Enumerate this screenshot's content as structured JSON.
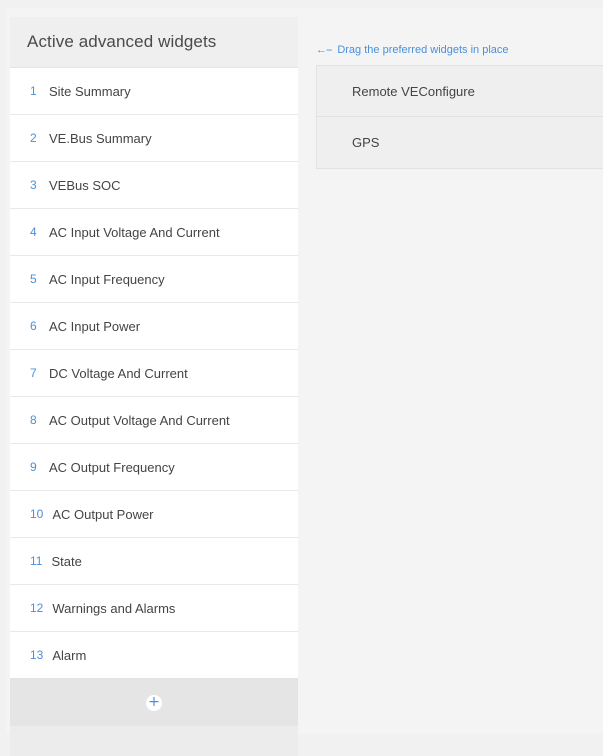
{
  "active_panel": {
    "title": "Active advanced widgets",
    "items": [
      {
        "num": "1",
        "label": "Site Summary"
      },
      {
        "num": "2",
        "label": "VE.Bus Summary"
      },
      {
        "num": "3",
        "label": "VEBus SOC"
      },
      {
        "num": "4",
        "label": "AC Input Voltage And Current"
      },
      {
        "num": "5",
        "label": "AC Input Frequency"
      },
      {
        "num": "6",
        "label": "AC Input Power"
      },
      {
        "num": "7",
        "label": "DC Voltage And Current"
      },
      {
        "num": "8",
        "label": "AC Output Voltage And Current"
      },
      {
        "num": "9",
        "label": "AC Output Frequency"
      },
      {
        "num": "10",
        "label": "AC Output Power"
      },
      {
        "num": "11",
        "label": "State"
      },
      {
        "num": "12",
        "label": "Warnings and Alarms"
      },
      {
        "num": "13",
        "label": "Alarm"
      }
    ],
    "add_icon": "plus-icon",
    "add_symbol": "+"
  },
  "available_panel": {
    "hint_arrow": "←--",
    "hint_text": "Drag the preferred widgets in place",
    "items": [
      {
        "label": "Remote VEConfigure"
      },
      {
        "label": "GPS"
      }
    ]
  },
  "colors": {
    "accent": "#4a90d9",
    "text": "#444444",
    "panel_bg": "#ececec",
    "item_bg": "#ffffff"
  }
}
